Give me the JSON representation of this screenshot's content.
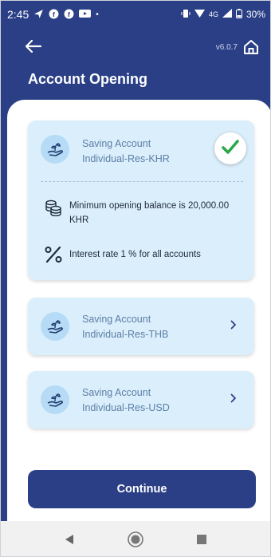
{
  "status_bar": {
    "time": "2:45",
    "network": "4G",
    "battery": "30%"
  },
  "header": {
    "version": "v6.0.7",
    "title": "Account Opening",
    "back_icon": "arrow-left-icon",
    "home_icon": "home-icon"
  },
  "accounts": [
    {
      "type": "Saving Account",
      "name": "Individual-Res-KHR",
      "selected": true
    },
    {
      "type": "Saving Account",
      "name": "Individual-Res-THB",
      "selected": false
    },
    {
      "type": "Saving Account",
      "name": "Individual-Res-USD",
      "selected": false
    }
  ],
  "details": {
    "min_balance": "Minimum opening balance is 20,000.00 KHR",
    "interest": "Interest rate 1 % for all accounts"
  },
  "continue_label": "Continue",
  "colors": {
    "primary": "#2a3f86",
    "card_bg": "#dbeefb",
    "check": "#2aa84a"
  }
}
